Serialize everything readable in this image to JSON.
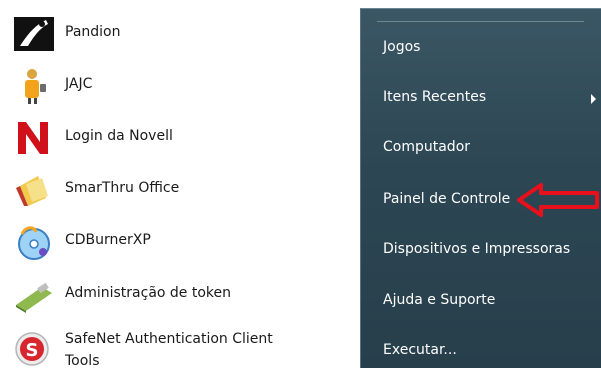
{
  "programs": [
    {
      "label": "Pandion",
      "icon": "pandion-icon"
    },
    {
      "label": "JAJC",
      "icon": "jajc-icon"
    },
    {
      "label": "Login da Novell",
      "icon": "novell-icon"
    },
    {
      "label": "SmarThru Office",
      "icon": "smarthru-icon"
    },
    {
      "label": "CDBurnerXP",
      "icon": "cdburner-icon"
    },
    {
      "label": "Administração de token",
      "icon": "token-icon"
    },
    {
      "label": "SafeNet Authentication Client",
      "label_line2": "Tools",
      "icon": "safenet-icon"
    }
  ],
  "menu": [
    {
      "label": "Jogos"
    },
    {
      "label": "Itens Recentes",
      "has_submenu": true
    },
    {
      "label": "Computador"
    },
    {
      "label": "Painel de Controle",
      "highlighted_by_arrow": true
    },
    {
      "label": "Dispositivos e Impressoras"
    },
    {
      "label": "Ajuda e Suporte"
    },
    {
      "label": "Executar..."
    }
  ],
  "colors": {
    "menu_bg": "#2c4653",
    "annotation_arrow": "#e8101a"
  }
}
